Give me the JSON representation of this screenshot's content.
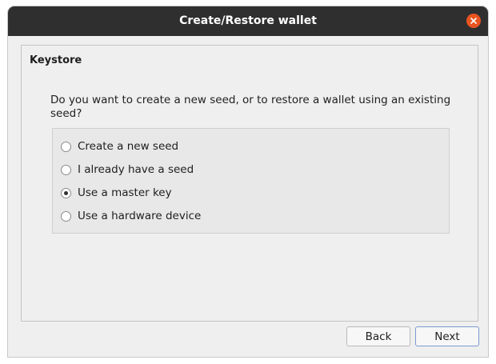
{
  "window": {
    "title": "Create/Restore wallet",
    "close_icon": "close-icon"
  },
  "panel": {
    "title": "Keystore",
    "question": "Do you want to create a new seed, or to restore a wallet using an existing seed?",
    "options": [
      {
        "label": "Create a new seed",
        "selected": false
      },
      {
        "label": "I already have a seed",
        "selected": false
      },
      {
        "label": "Use a master key",
        "selected": true
      },
      {
        "label": "Use a hardware device",
        "selected": false
      }
    ]
  },
  "buttons": {
    "back_label": "Back",
    "next_label": "Next"
  },
  "colors": {
    "titlebar": "#2f2f2f",
    "close_button": "#e95420",
    "background": "#efefef"
  }
}
